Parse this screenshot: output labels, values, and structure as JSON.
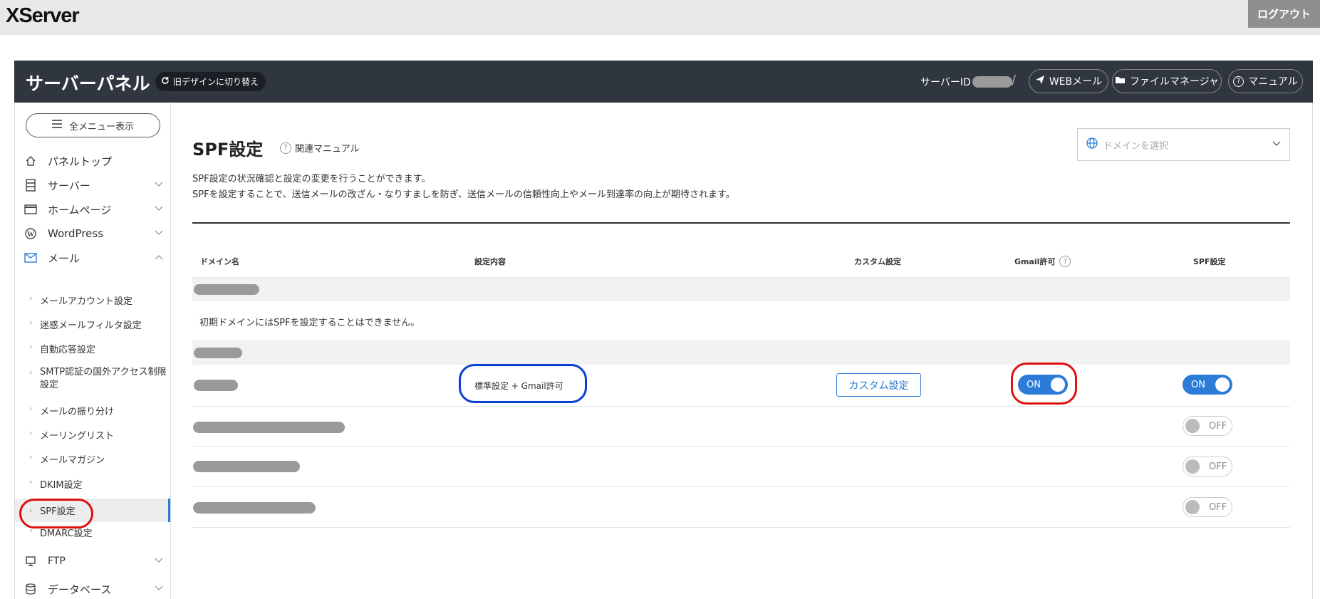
{
  "brand": {
    "logo": "XServer",
    "logout": "ログアウト"
  },
  "header": {
    "title": "サーバーパネル",
    "old_design": "旧デザインに切り替え",
    "server_id_label": "サーバーID",
    "separator": "/",
    "webmail": "WEBメール",
    "file_manager": "ファイルマネージャ",
    "manual": "マニュアル"
  },
  "sidebar": {
    "menu_all": "全メニュー表示",
    "items": [
      {
        "label": "パネルトップ",
        "icon": "home-icon"
      },
      {
        "label": "サーバー",
        "icon": "server-icon"
      },
      {
        "label": "ホームページ",
        "icon": "browser-icon"
      },
      {
        "label": "WordPress",
        "icon": "wordpress-icon"
      },
      {
        "label": "メール",
        "icon": "mail-icon"
      }
    ],
    "mail_sub": [
      "メールアカウント設定",
      "迷惑メールフィルタ設定",
      "自動応答設定",
      "SMTP認証の国外アクセス制限設定",
      "メールの振り分け",
      "メーリングリスト",
      "メールマガジン",
      "DKIM設定",
      "SPF設定",
      "DMARC設定"
    ],
    "bottom_items": [
      {
        "label": "FTP",
        "icon": "monitor-icon"
      },
      {
        "label": "データベース",
        "icon": "database-icon"
      }
    ]
  },
  "main": {
    "title": "SPF設定",
    "manual_link": "関連マニュアル",
    "domain_placeholder": "ドメインを選択",
    "desc1": "SPF設定の状況確認と設定の変更を行うことができます。",
    "desc2": "SPFを設定することで、送信メールの改ざん・なりすましを防ぎ、送信メールの信頼性向上やメール到達率の向上が期待されます。",
    "columns": {
      "domain": "ドメイン名",
      "setting": "設定内容",
      "custom": "カスタム設定",
      "gmail": "Gmail許可",
      "spf": "SPF設定"
    },
    "initial_note": "初期ドメインにはSPFを設定することはできません。",
    "row_setting": "標準設定 + Gmail許可",
    "custom_button": "カスタム設定",
    "toggle_on": "ON",
    "toggle_off": "OFF"
  },
  "colors": {
    "accent": "#2b7bd7",
    "dark_header": "#2f3640",
    "annotation_red": "#e01010",
    "annotation_blue": "#0a3fd6"
  }
}
